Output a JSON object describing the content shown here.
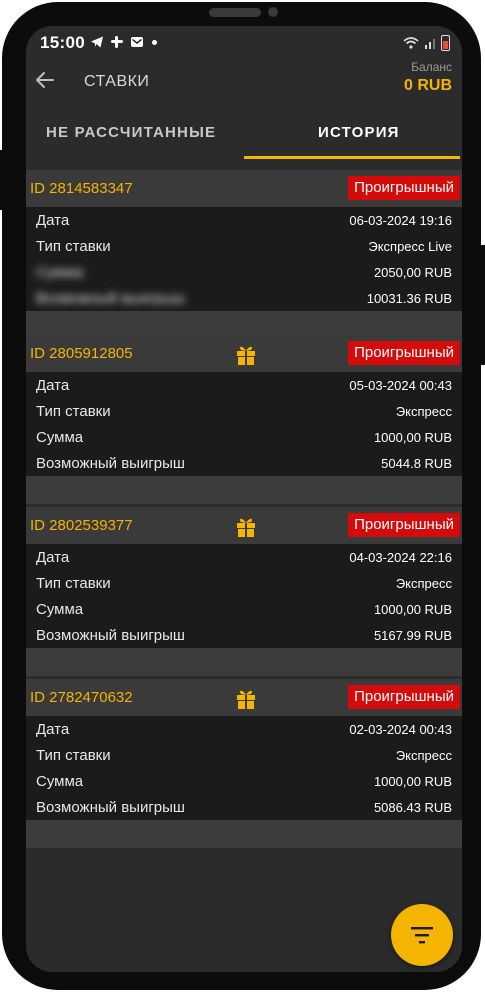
{
  "status_bar": {
    "time": "15:00"
  },
  "header": {
    "title": "СТАВКИ",
    "balance_label": "Баланс",
    "balance_value": "0 RUB"
  },
  "tabs": [
    {
      "label": "НЕ РАССЧИТАННЫЕ",
      "active": false
    },
    {
      "label": "ИСТОРИЯ",
      "active": true
    }
  ],
  "bets": [
    {
      "id": "ID 2814583347",
      "has_gift": false,
      "status": "Проигрышный",
      "rows": [
        {
          "label": "Дата",
          "value": "06-03-2024 19:16"
        },
        {
          "label": "Тип ставки",
          "value": "Экспресс Live"
        },
        {
          "label": "Сумма",
          "value": "2050,00 RUB"
        },
        {
          "label": "Возможный выигрыш",
          "value": "10031.36 RUB"
        }
      ]
    },
    {
      "id": "ID 2805912805",
      "has_gift": true,
      "status": "Проигрышный",
      "rows": [
        {
          "label": "Дата",
          "value": "05-03-2024 00:43"
        },
        {
          "label": "Тип ставки",
          "value": "Экспресс"
        },
        {
          "label": "Сумма",
          "value": "1000,00 RUB"
        },
        {
          "label": "Возможный выигрыш",
          "value": "5044.8 RUB"
        }
      ]
    },
    {
      "id": "ID 2802539377",
      "has_gift": true,
      "status": "Проигрышный",
      "rows": [
        {
          "label": "Дата",
          "value": "04-03-2024 22:16"
        },
        {
          "label": "Тип ставки",
          "value": "Экспресс"
        },
        {
          "label": "Сумма",
          "value": "1000,00 RUB"
        },
        {
          "label": "Возможный выигрыш",
          "value": "5167.99 RUB"
        }
      ]
    },
    {
      "id": "ID 2782470632",
      "has_gift": true,
      "status": "Проигрышный",
      "rows": [
        {
          "label": "Дата",
          "value": "02-03-2024 00:43"
        },
        {
          "label": "Тип ставки",
          "value": "Экспресс"
        },
        {
          "label": "Сумма",
          "value": "1000,00 RUB"
        },
        {
          "label": "Возможный выигрыш",
          "value": "5086.43 RUB"
        }
      ]
    }
  ],
  "colors": {
    "accent": "#f4b400",
    "lost_badge": "#d50b0b",
    "background": "#2b2b2b"
  },
  "icons": [
    "back-arrow-icon",
    "gift-icon",
    "filter-icon"
  ]
}
